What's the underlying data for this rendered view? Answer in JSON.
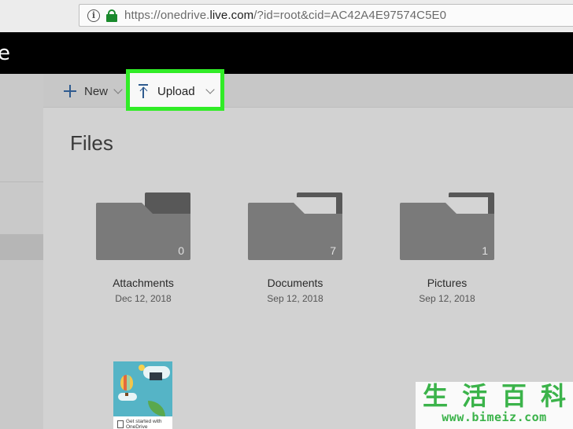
{
  "browser": {
    "url_prefix": "https://onedrive.",
    "url_host": "live.com",
    "url_path": "/?id=root&cid=AC42A4E97574C5E0",
    "lock_color": "#1a8a2d"
  },
  "app": {
    "title_fragment": "e"
  },
  "toolbar": {
    "new_label": "New",
    "upload_label": "Upload",
    "highlight_color": "#31ec27"
  },
  "page": {
    "title": "Files"
  },
  "folders": [
    {
      "name": "Attachments",
      "date": "Dec 12, 2018",
      "count": "0"
    },
    {
      "name": "Documents",
      "date": "Sep 12, 2018",
      "count": "7"
    },
    {
      "name": "Pictures",
      "date": "Sep 12, 2018",
      "count": "1"
    }
  ],
  "thumbnail": {
    "caption": "Get started with OneDrive"
  },
  "watermark": {
    "chars": [
      "生",
      "活",
      "百",
      "科"
    ],
    "url": "www.bimeiz.com"
  }
}
